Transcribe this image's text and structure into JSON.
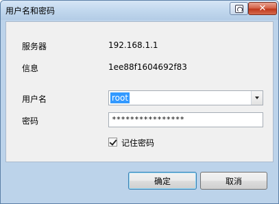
{
  "window": {
    "title": "用户名和密码",
    "help_icon": "help-icon",
    "close_label": "✕"
  },
  "form": {
    "server_label": "服务器",
    "server_value": "192.168.1.1",
    "info_label": "信息",
    "info_value": "1ee88f1604692f83",
    "username_label": "用户名",
    "username_value": "root",
    "password_label": "密码",
    "password_value": "****************",
    "remember_label": "记住密码",
    "remember_checked": true
  },
  "buttons": {
    "ok_label": "确定",
    "cancel_label": "取消"
  },
  "colors": {
    "titlebar": "#c2d8ee",
    "selection": "#3399ff",
    "close": "#c0391d"
  }
}
